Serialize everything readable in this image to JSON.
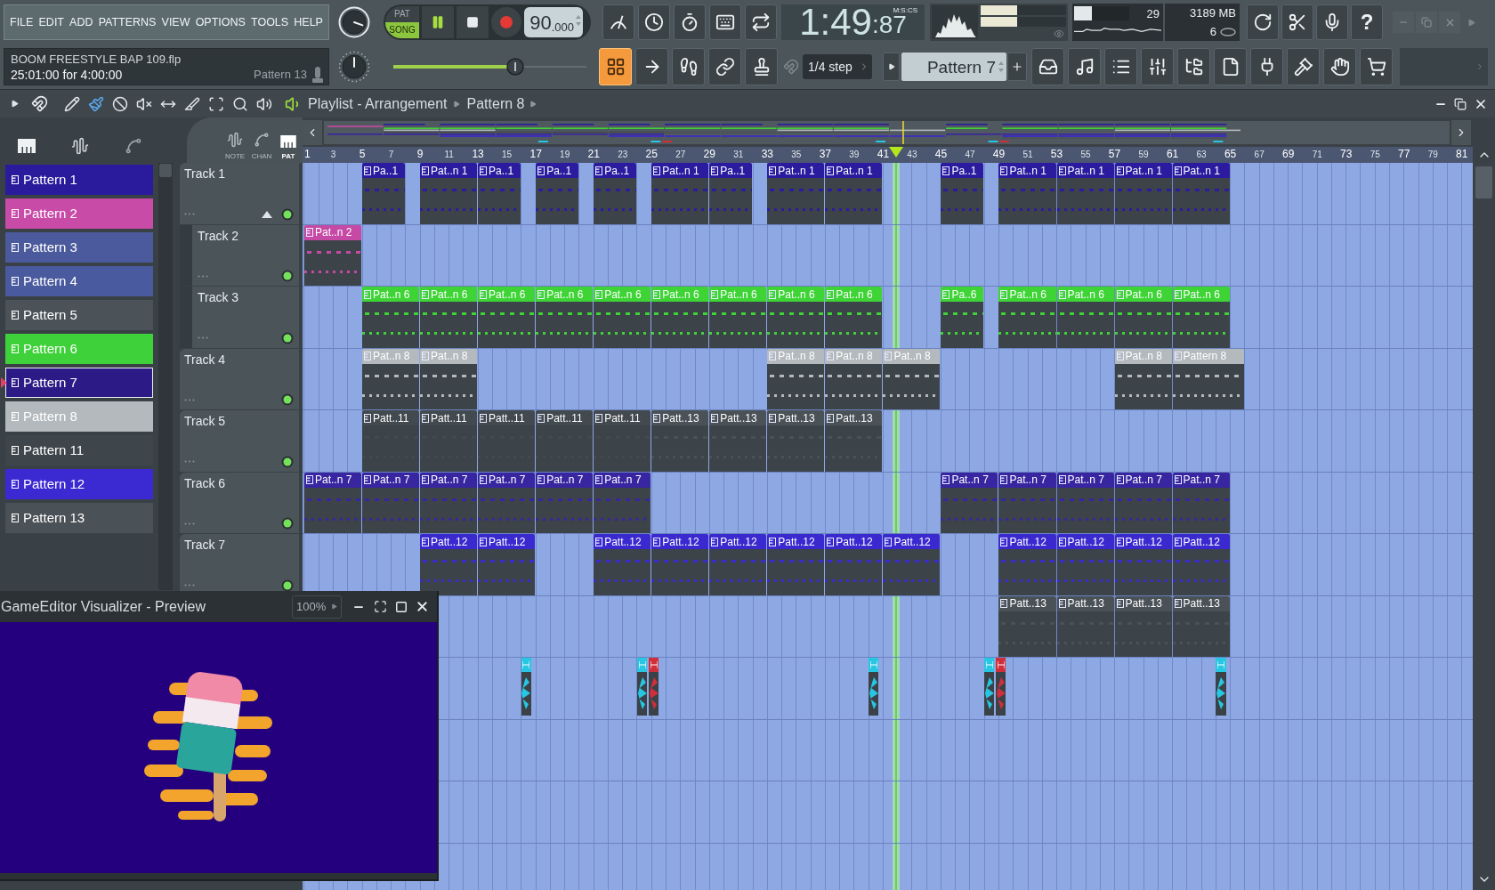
{
  "menu": [
    "FILE",
    "EDIT",
    "ADD",
    "PATTERNS",
    "VIEW",
    "OPTIONS",
    "TOOLS",
    "HELP"
  ],
  "transport": {
    "modes": [
      {
        "label": "PAT",
        "selected": false
      },
      {
        "label": "SONG",
        "selected": true
      }
    ],
    "playing": true,
    "tempo": {
      "value": "90",
      "decimals": ".000"
    }
  },
  "time": {
    "value": "1:49",
    "fraction": ":87",
    "unit": "M:S:CS"
  },
  "peak_meters": [
    {
      "level": 0.43
    },
    {
      "level": 0.43
    }
  ],
  "cpu": {
    "level": 0.33,
    "value": "29"
  },
  "memory": "3189 MB",
  "polyphony": "6",
  "help_button": "?",
  "song": {
    "file": "BOOM FREESTYLE BAP 109.flp",
    "position": "25:01:00 for 4:00:00",
    "pattern": "Pattern 13"
  },
  "position_slider": {
    "level": 0.63
  },
  "grid_button": {
    "on": true
  },
  "snap": "1/4 step",
  "pattern_selector": "Pattern 7",
  "playlist": {
    "title": "Playlist - Arrangement",
    "pattern": "Pattern 8",
    "tabs": [
      {
        "label": "NOTE",
        "selected": false
      },
      {
        "label": "CHAN",
        "selected": false
      },
      {
        "label": "PAT",
        "selected": true
      }
    ],
    "ruler": [
      "1",
      "3",
      "5",
      "7",
      "9",
      "11",
      "13",
      "15",
      "17",
      "19",
      "21",
      "23",
      "25",
      "27",
      "29",
      "31",
      "33",
      "35",
      "37",
      "39",
      "41",
      "43",
      "45",
      "47",
      "49",
      "51",
      "53",
      "55",
      "57",
      "59",
      "61",
      "63",
      "65",
      "67",
      "69",
      "71",
      "73",
      "75",
      "77",
      "79",
      "81"
    ]
  },
  "patterns": [
    {
      "name": "Pattern 1",
      "color": "#2a1a9c",
      "selected": false
    },
    {
      "name": "Pattern 2",
      "color": "#c84ba8",
      "selected": false
    },
    {
      "name": "Pattern 3",
      "color": "#4b5a9c",
      "selected": false
    },
    {
      "name": "Pattern 4",
      "color": "#4a5a9e",
      "selected": false
    },
    {
      "name": "Pattern 5",
      "color": "#4b5358",
      "selected": false
    },
    {
      "name": "Pattern 6",
      "color": "#3fd13a",
      "selected": false
    },
    {
      "name": "Pattern 7",
      "color": "#2c1a86",
      "selected": true
    },
    {
      "name": "Pattern 8",
      "color": "#b4b9bd",
      "selected": false
    },
    {
      "name": "Pattern 11",
      "color": "#3f464b",
      "selected": false
    },
    {
      "name": "Pattern 12",
      "color": "#3b29d2",
      "selected": false
    },
    {
      "name": "Pattern 13",
      "color": "#4b5257",
      "selected": false
    }
  ],
  "tracks": [
    {
      "name": "Track 1",
      "expanded": true,
      "on": true,
      "clips": [
        {
          "kind": "pattern",
          "label": "Pa..1",
          "color": "#2b1c9f"
        },
        {
          "kind": "pattern",
          "label": "Pat..n 1",
          "color": "#2b1c9f"
        },
        {
          "kind": "pattern",
          "label": "Pa..1",
          "color": "#2b1c9f"
        },
        {
          "kind": "pattern",
          "label": "Pa..1",
          "color": "#2b1c9f"
        },
        {
          "kind": "pattern",
          "label": "Pa..1",
          "color": "#2b1c9f"
        },
        {
          "kind": "pattern",
          "label": "Pat..n 1",
          "color": "#2b1c9f"
        },
        {
          "kind": "pattern",
          "label": "Pa..1",
          "color": "#2b1c9f"
        },
        {
          "kind": "pattern",
          "label": "Pat..n 1",
          "color": "#2b1c9f"
        },
        {
          "kind": "pattern",
          "label": "Pat..n 1",
          "color": "#2b1c9f"
        },
        {
          "kind": "pattern",
          "label": "Pa..1",
          "color": "#2b1c9f"
        },
        {
          "kind": "pattern",
          "label": "Pat..n 1",
          "color": "#2b1c9f"
        },
        {
          "kind": "pattern",
          "label": "Pat..n 1",
          "color": "#2b1c9f"
        },
        {
          "kind": "pattern",
          "label": "Pat..n 1",
          "color": "#2b1c9f"
        },
        {
          "kind": "pattern",
          "label": "Pat..n 1",
          "color": "#2b1c9f"
        }
      ],
      "children": [
        {
          "name": "Track 2",
          "on": true,
          "clips": [
            {
              "kind": "pattern",
              "label": "Pat..n 2",
              "color": "#c64aa5"
            }
          ]
        },
        {
          "name": "Track 3",
          "on": true,
          "clips": [
            {
              "kind": "pattern",
              "label": "Pat..n 6",
              "color": "#3ed436"
            },
            {
              "kind": "pattern",
              "label": "Pat..n 6",
              "color": "#3ed436"
            },
            {
              "kind": "pattern",
              "label": "Pat..n 6",
              "color": "#3ed436"
            },
            {
              "kind": "pattern",
              "label": "Pat..n 6",
              "color": "#3ed436"
            },
            {
              "kind": "pattern",
              "label": "Pat..n 6",
              "color": "#3ed436"
            },
            {
              "kind": "pattern",
              "label": "Pat..n 6",
              "color": "#3ed436"
            },
            {
              "kind": "pattern",
              "label": "Pat..n 6",
              "color": "#3ed436"
            },
            {
              "kind": "pattern",
              "label": "Pat..n 6",
              "color": "#3ed436"
            },
            {
              "kind": "pattern",
              "label": "Pat..n 6",
              "color": "#3ed436"
            },
            {
              "kind": "pattern",
              "label": "Pa..6",
              "color": "#3ed436"
            },
            {
              "kind": "pattern",
              "label": "Pat..n 6",
              "color": "#3ed436"
            },
            {
              "kind": "pattern",
              "label": "Pat..n 6",
              "color": "#3ed436"
            },
            {
              "kind": "pattern",
              "label": "Pat..n 6",
              "color": "#3ed436"
            },
            {
              "kind": "pattern",
              "label": "Pat..n 6",
              "color": "#3ed436"
            }
          ]
        }
      ]
    },
    {
      "name": "Track 4",
      "on": true,
      "clips": [
        {
          "kind": "pattern",
          "label": "Pat..n 8",
          "color": "#b4b9bd"
        },
        {
          "kind": "pattern",
          "label": "Pat..n 8",
          "color": "#b4b9bd"
        },
        {
          "kind": "pattern",
          "label": "Pat..n 8",
          "color": "#b4b9bd"
        },
        {
          "kind": "pattern",
          "label": "Pat..n 8",
          "color": "#b4b9bd"
        },
        {
          "kind": "pattern",
          "label": "Pat..n 8",
          "color": "#b4b9bd"
        },
        {
          "kind": "pattern",
          "label": "Pat..n 8",
          "color": "#b4b9bd"
        },
        {
          "kind": "pattern",
          "label": "Pattern 8",
          "color": "#b4b9bd"
        }
      ]
    },
    {
      "name": "Track 5",
      "on": true,
      "clips": [
        {
          "kind": "pattern",
          "label": "Patt..11",
          "color": "#42494f"
        },
        {
          "kind": "pattern",
          "label": "Patt..11",
          "color": "#42494f"
        },
        {
          "kind": "pattern",
          "label": "Patt..11",
          "color": "#42494f"
        },
        {
          "kind": "pattern",
          "label": "Patt..11",
          "color": "#42494f"
        },
        {
          "kind": "pattern",
          "label": "Patt..11",
          "color": "#42494f"
        },
        {
          "kind": "pattern",
          "label": "Patt..13",
          "color": "#4a5157"
        },
        {
          "kind": "pattern",
          "label": "Patt..13",
          "color": "#4a5157"
        },
        {
          "kind": "pattern",
          "label": "Patt..13",
          "color": "#4a5157"
        },
        {
          "kind": "pattern",
          "label": "Patt..13",
          "color": "#4a5157"
        }
      ]
    },
    {
      "name": "Track 6",
      "on": true,
      "clips": [
        {
          "kind": "pattern",
          "label": "Pat..n 7",
          "color": "#3726a0"
        },
        {
          "kind": "pattern",
          "label": "Pat..n 7",
          "color": "#3726a0"
        },
        {
          "kind": "pattern",
          "label": "Pat..n 7",
          "color": "#3726a0"
        },
        {
          "kind": "pattern",
          "label": "Pat..n 7",
          "color": "#3726a0"
        },
        {
          "kind": "pattern",
          "label": "Pat..n 7",
          "color": "#3726a0"
        },
        {
          "kind": "pattern",
          "label": "Pat..n 7",
          "color": "#3726a0"
        },
        {
          "kind": "pattern",
          "label": "Pat..n 7",
          "color": "#3726a0"
        },
        {
          "kind": "pattern",
          "label": "Pat..n 7",
          "color": "#3726a0"
        },
        {
          "kind": "pattern",
          "label": "Pat..n 7",
          "color": "#3726a0"
        },
        {
          "kind": "pattern",
          "label": "Pat..n 7",
          "color": "#3726a0"
        },
        {
          "kind": "pattern",
          "label": "Pat..n 7",
          "color": "#3726a0"
        }
      ]
    },
    {
      "name": "Track 7",
      "on": true,
      "clips": [
        {
          "kind": "pattern",
          "label": "Patt..12",
          "color": "#3a29cf"
        },
        {
          "kind": "pattern",
          "label": "Patt..12",
          "color": "#3a29cf"
        },
        {
          "kind": "pattern",
          "label": "Patt..12",
          "color": "#3a29cf"
        },
        {
          "kind": "pattern",
          "label": "Patt..12",
          "color": "#3a29cf"
        },
        {
          "kind": "pattern",
          "label": "Patt..12",
          "color": "#3a29cf"
        },
        {
          "kind": "pattern",
          "label": "Patt..12",
          "color": "#3a29cf"
        },
        {
          "kind": "pattern",
          "label": "Patt..12",
          "color": "#3a29cf"
        },
        {
          "kind": "pattern",
          "label": "Patt..12",
          "color": "#3a29cf"
        },
        {
          "kind": "pattern",
          "label": "Patt..12",
          "color": "#3a29cf"
        },
        {
          "kind": "pattern",
          "label": "Patt..12",
          "color": "#3a29cf"
        },
        {
          "kind": "pattern",
          "label": "Patt..12",
          "color": "#3a29cf"
        },
        {
          "kind": "pattern",
          "label": "Patt..12",
          "color": "#3a29cf"
        }
      ]
    },
    {
      "clips": [
        {
          "kind": "pattern",
          "label": "Patt..13",
          "color": "#4a5157"
        },
        {
          "kind": "pattern",
          "label": "Patt..13",
          "color": "#4a5157"
        },
        {
          "kind": "pattern",
          "label": "Patt..13",
          "color": "#4a5157"
        },
        {
          "kind": "pattern",
          "label": "Patt..13",
          "color": "#4a5157"
        }
      ]
    },
    {
      "clips": [
        {
          "kind": "audio",
          "color": "#27c6e2"
        },
        {
          "kind": "audio",
          "color": "#27c6e2"
        },
        {
          "kind": "audio",
          "color": "#cf2f3b"
        },
        {
          "kind": "audio",
          "color": "#27c6e2"
        },
        {
          "kind": "audio",
          "color": "#27c6e2"
        },
        {
          "kind": "audio",
          "color": "#cf2f3b"
        },
        {
          "kind": "audio",
          "color": "#27c6e2"
        }
      ]
    }
  ],
  "visualizer": {
    "title": "GameEditor Visualizer - Preview",
    "zoom": "100%"
  }
}
